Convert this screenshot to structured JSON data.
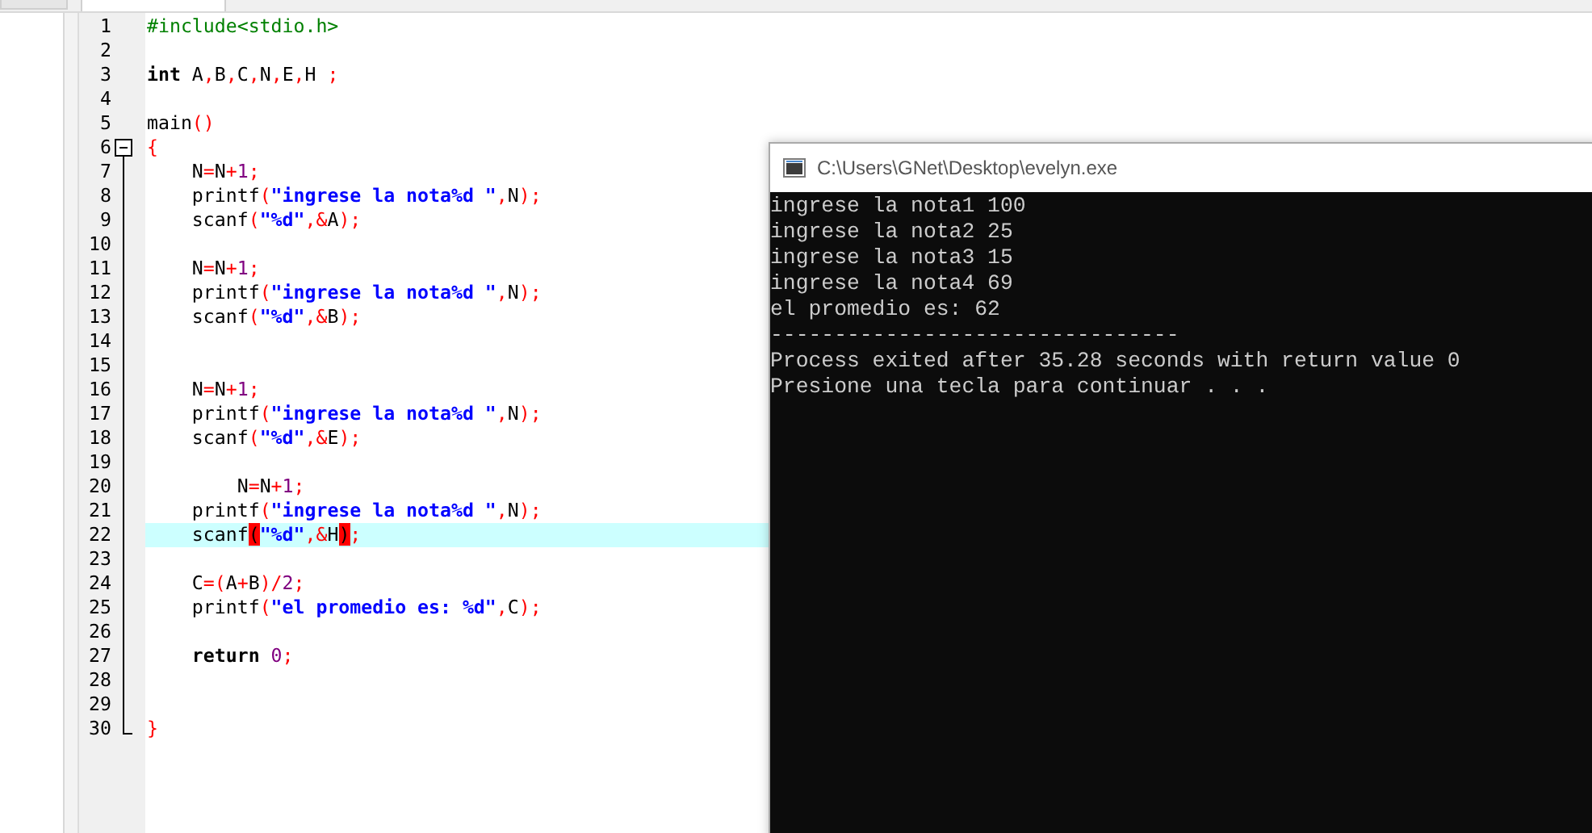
{
  "editor": {
    "lines": [
      {
        "number": "1",
        "kind": "plain",
        "highlighted": false,
        "tokens": [
          {
            "text": "#include<stdio.h>",
            "kind": "preproc"
          }
        ]
      },
      {
        "number": "2",
        "kind": "plain",
        "highlighted": false
      },
      {
        "number": "3",
        "kind": "plain",
        "highlighted": false,
        "tokens": [
          {
            "text": "int",
            "kind": "keyword"
          },
          {
            "text": " A",
            "kind": "ident"
          },
          {
            "text": ",",
            "kind": "op"
          },
          {
            "text": "B",
            "kind": "ident"
          },
          {
            "text": ",",
            "kind": "op"
          },
          {
            "text": "C",
            "kind": "ident"
          },
          {
            "text": ",",
            "kind": "op"
          },
          {
            "text": "N",
            "kind": "ident"
          },
          {
            "text": ",",
            "kind": "op"
          },
          {
            "text": "E",
            "kind": "ident"
          },
          {
            "text": ",",
            "kind": "op"
          },
          {
            "text": "H ",
            "kind": "ident"
          },
          {
            "text": ";",
            "kind": "op"
          }
        ]
      },
      {
        "number": "4",
        "kind": "plain",
        "highlighted": false
      },
      {
        "number": "5",
        "kind": "plain",
        "highlighted": false,
        "tokens": [
          {
            "text": "main",
            "kind": "ident"
          },
          {
            "text": "()",
            "kind": "op"
          }
        ]
      },
      {
        "number": "6",
        "kind": "foldstart",
        "highlighted": false,
        "tokens": [
          {
            "text": "{",
            "kind": "op"
          }
        ]
      },
      {
        "number": "7",
        "kind": "foldbody",
        "highlighted": false,
        "tokens": [
          {
            "text": "    N",
            "kind": "ident"
          },
          {
            "text": "=",
            "kind": "op"
          },
          {
            "text": "N",
            "kind": "ident"
          },
          {
            "text": "+",
            "kind": "op"
          },
          {
            "text": "1",
            "kind": "number"
          },
          {
            "text": ";",
            "kind": "op"
          }
        ]
      },
      {
        "number": "8",
        "kind": "foldbody",
        "highlighted": false,
        "tokens": [
          {
            "text": "    printf",
            "kind": "ident"
          },
          {
            "text": "(",
            "kind": "op"
          },
          {
            "text": "\"ingrese la nota%d \"",
            "kind": "string"
          },
          {
            "text": ",",
            "kind": "op"
          },
          {
            "text": "N",
            "kind": "ident"
          },
          {
            "text": ");",
            "kind": "op"
          }
        ]
      },
      {
        "number": "9",
        "kind": "foldbody",
        "highlighted": false,
        "tokens": [
          {
            "text": "    scanf",
            "kind": "ident"
          },
          {
            "text": "(",
            "kind": "op"
          },
          {
            "text": "\"%d\"",
            "kind": "string"
          },
          {
            "text": ",&",
            "kind": "op"
          },
          {
            "text": "A",
            "kind": "ident"
          },
          {
            "text": ");",
            "kind": "op"
          }
        ]
      },
      {
        "number": "10",
        "kind": "foldbody",
        "highlighted": false
      },
      {
        "number": "11",
        "kind": "foldbody",
        "highlighted": false,
        "tokens": [
          {
            "text": "    N",
            "kind": "ident"
          },
          {
            "text": "=",
            "kind": "op"
          },
          {
            "text": "N",
            "kind": "ident"
          },
          {
            "text": "+",
            "kind": "op"
          },
          {
            "text": "1",
            "kind": "number"
          },
          {
            "text": ";",
            "kind": "op"
          }
        ]
      },
      {
        "number": "12",
        "kind": "foldbody",
        "highlighted": false,
        "tokens": [
          {
            "text": "    printf",
            "kind": "ident"
          },
          {
            "text": "(",
            "kind": "op"
          },
          {
            "text": "\"ingrese la nota%d \"",
            "kind": "string"
          },
          {
            "text": ",",
            "kind": "op"
          },
          {
            "text": "N",
            "kind": "ident"
          },
          {
            "text": ");",
            "kind": "op"
          }
        ]
      },
      {
        "number": "13",
        "kind": "foldbody",
        "highlighted": false,
        "tokens": [
          {
            "text": "    scanf",
            "kind": "ident"
          },
          {
            "text": "(",
            "kind": "op"
          },
          {
            "text": "\"%d\"",
            "kind": "string"
          },
          {
            "text": ",&",
            "kind": "op"
          },
          {
            "text": "B",
            "kind": "ident"
          },
          {
            "text": ");",
            "kind": "op"
          }
        ]
      },
      {
        "number": "14",
        "kind": "foldbody",
        "highlighted": false
      },
      {
        "number": "15",
        "kind": "foldbody",
        "highlighted": false
      },
      {
        "number": "16",
        "kind": "foldbody",
        "highlighted": false,
        "tokens": [
          {
            "text": "    N",
            "kind": "ident"
          },
          {
            "text": "=",
            "kind": "op"
          },
          {
            "text": "N",
            "kind": "ident"
          },
          {
            "text": "+",
            "kind": "op"
          },
          {
            "text": "1",
            "kind": "number"
          },
          {
            "text": ";",
            "kind": "op"
          }
        ]
      },
      {
        "number": "17",
        "kind": "foldbody",
        "highlighted": false,
        "tokens": [
          {
            "text": "    printf",
            "kind": "ident"
          },
          {
            "text": "(",
            "kind": "op"
          },
          {
            "text": "\"ingrese la nota%d \"",
            "kind": "string"
          },
          {
            "text": ",",
            "kind": "op"
          },
          {
            "text": "N",
            "kind": "ident"
          },
          {
            "text": ");",
            "kind": "op"
          }
        ]
      },
      {
        "number": "18",
        "kind": "foldbody",
        "highlighted": false,
        "tokens": [
          {
            "text": "    scanf",
            "kind": "ident"
          },
          {
            "text": "(",
            "kind": "op"
          },
          {
            "text": "\"%d\"",
            "kind": "string"
          },
          {
            "text": ",&",
            "kind": "op"
          },
          {
            "text": "E",
            "kind": "ident"
          },
          {
            "text": ");",
            "kind": "op"
          }
        ]
      },
      {
        "number": "19",
        "kind": "foldbody",
        "highlighted": false
      },
      {
        "number": "20",
        "kind": "foldbody",
        "highlighted": false,
        "tokens": [
          {
            "text": "        N",
            "kind": "ident"
          },
          {
            "text": "=",
            "kind": "op"
          },
          {
            "text": "N",
            "kind": "ident"
          },
          {
            "text": "+",
            "kind": "op"
          },
          {
            "text": "1",
            "kind": "number"
          },
          {
            "text": ";",
            "kind": "op"
          }
        ]
      },
      {
        "number": "21",
        "kind": "foldbody",
        "highlighted": false,
        "tokens": [
          {
            "text": "    printf",
            "kind": "ident"
          },
          {
            "text": "(",
            "kind": "op"
          },
          {
            "text": "\"ingrese la nota%d \"",
            "kind": "string"
          },
          {
            "text": ",",
            "kind": "op"
          },
          {
            "text": "N",
            "kind": "ident"
          },
          {
            "text": ");",
            "kind": "op"
          }
        ]
      },
      {
        "number": "22",
        "kind": "foldbody",
        "highlighted": true,
        "tokens": [
          {
            "text": "    scanf",
            "kind": "ident"
          },
          {
            "text": "(",
            "kind": "match"
          },
          {
            "text": "\"%d\"",
            "kind": "string"
          },
          {
            "text": ",&",
            "kind": "op"
          },
          {
            "text": "H",
            "kind": "ident"
          },
          {
            "text": ")",
            "kind": "match"
          },
          {
            "text": ";",
            "kind": "op"
          }
        ]
      },
      {
        "number": "23",
        "kind": "foldbody",
        "highlighted": false
      },
      {
        "number": "24",
        "kind": "foldbody",
        "highlighted": false,
        "tokens": [
          {
            "text": "    C",
            "kind": "ident"
          },
          {
            "text": "=(",
            "kind": "op"
          },
          {
            "text": "A",
            "kind": "ident"
          },
          {
            "text": "+",
            "kind": "op"
          },
          {
            "text": "B",
            "kind": "ident"
          },
          {
            "text": ")/",
            "kind": "op"
          },
          {
            "text": "2",
            "kind": "number"
          },
          {
            "text": ";",
            "kind": "op"
          }
        ]
      },
      {
        "number": "25",
        "kind": "foldbody",
        "highlighted": false,
        "tokens": [
          {
            "text": "    printf",
            "kind": "ident"
          },
          {
            "text": "(",
            "kind": "op"
          },
          {
            "text": "\"el promedio es: %d\"",
            "kind": "string"
          },
          {
            "text": ",",
            "kind": "op"
          },
          {
            "text": "C",
            "kind": "ident"
          },
          {
            "text": ");",
            "kind": "op"
          }
        ]
      },
      {
        "number": "26",
        "kind": "foldbody",
        "highlighted": false
      },
      {
        "number": "27",
        "kind": "foldbody",
        "highlighted": false,
        "tokens": [
          {
            "text": "    return ",
            "kind": "keyword"
          },
          {
            "text": "0",
            "kind": "number"
          },
          {
            "text": ";",
            "kind": "op"
          }
        ]
      },
      {
        "number": "28",
        "kind": "foldbody",
        "highlighted": false
      },
      {
        "number": "29",
        "kind": "foldbody",
        "highlighted": false
      },
      {
        "number": "30",
        "kind": "foldend",
        "highlighted": false,
        "tokens": [
          {
            "text": "}",
            "kind": "op"
          }
        ]
      }
    ]
  },
  "console": {
    "title": "C:\\Users\\GNet\\Desktop\\evelyn.exe",
    "lines": [
      "ingrese la nota1 100",
      "ingrese la nota2 25",
      "ingrese la nota3 15",
      "ingrese la nota4 69",
      "el promedio es: 62",
      "--------------------------------",
      "Process exited after 35.28 seconds with return value 0",
      "Presione una tecla para continuar . . ."
    ]
  }
}
